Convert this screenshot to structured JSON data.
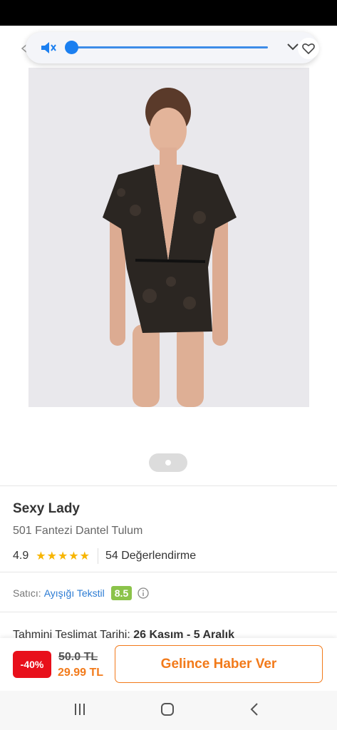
{
  "icons": [
    "volume-mute-icon",
    "chevron-down-icon",
    "heart-icon",
    "info-icon",
    "nav-recents-icon",
    "nav-home-icon",
    "nav-back-icon"
  ],
  "volume": {
    "level": 0.0
  },
  "product": {
    "brand": "Sexy Lady",
    "subtitle": "501  Fantezi Dantel Tulum",
    "rating": "4.9",
    "stars": 5,
    "reviews": "54 Değerlendirme",
    "image_page": 1,
    "image_count": 1
  },
  "seller": {
    "label": "Satıcı:",
    "name": "Ayışığı Tekstil",
    "score": "8.5"
  },
  "delivery": {
    "label": "Tahmini Teslimat Tarihi:",
    "range": "26 Kasım - 5 Aralık"
  },
  "pricing": {
    "discount": "-40%",
    "old_price": "50.0 TL",
    "new_price": "29.99 TL",
    "notify_label": "Gelince Haber Ver"
  },
  "colors": {
    "accent": "#f27a1a",
    "discount": "#e8101b",
    "seller_score": "#8bc34a",
    "link": "#2b7bd3",
    "star": "#f7b500"
  }
}
